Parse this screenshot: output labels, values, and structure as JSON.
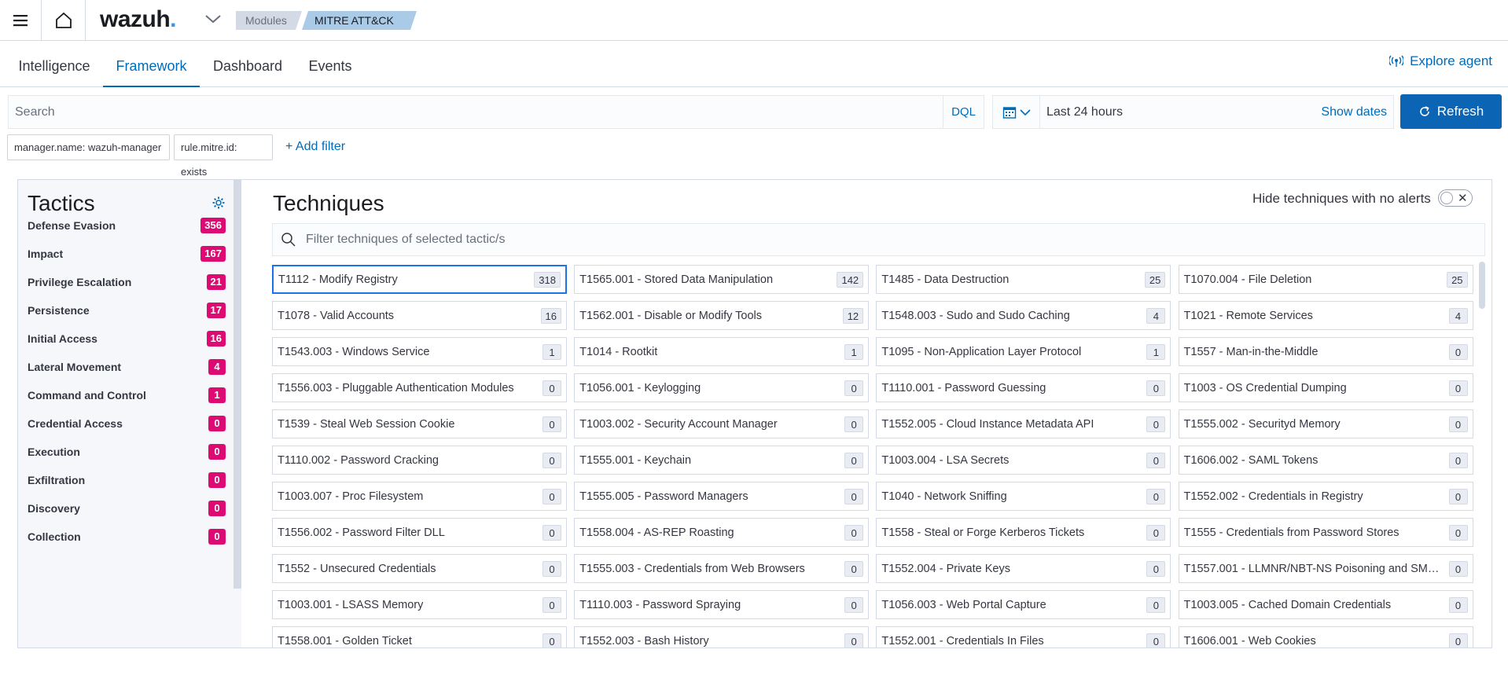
{
  "header": {
    "logo_text": "wazuh",
    "logo_dot": ".",
    "breadcrumbs": [
      "Modules",
      "MITRE ATT&CK"
    ],
    "info_icon": "info-icon"
  },
  "tabs": [
    {
      "label": "Intelligence",
      "active": false
    },
    {
      "label": "Framework",
      "active": true
    },
    {
      "label": "Dashboard",
      "active": false
    },
    {
      "label": "Events",
      "active": false
    }
  ],
  "explore_agent": "Explore agent",
  "search": {
    "placeholder": "Search",
    "value": "",
    "dql_label": "DQL"
  },
  "date_picker": {
    "label": "Last 24 hours",
    "show_dates": "Show dates"
  },
  "refresh_label": "Refresh",
  "filters": [
    "manager.name: wazuh-manager",
    "rule.mitre.id: exists"
  ],
  "add_filter": "+ Add filter",
  "tactics": {
    "title": "Tactics",
    "items": [
      {
        "label": "Defense Evasion",
        "count": "356"
      },
      {
        "label": "Impact",
        "count": "167"
      },
      {
        "label": "Privilege Escalation",
        "count": "21"
      },
      {
        "label": "Persistence",
        "count": "17"
      },
      {
        "label": "Initial Access",
        "count": "16"
      },
      {
        "label": "Lateral Movement",
        "count": "4"
      },
      {
        "label": "Command and Control",
        "count": "1"
      },
      {
        "label": "Credential Access",
        "count": "0"
      },
      {
        "label": "Execution",
        "count": "0"
      },
      {
        "label": "Exfiltration",
        "count": "0"
      },
      {
        "label": "Discovery",
        "count": "0"
      },
      {
        "label": "Collection",
        "count": "0"
      }
    ]
  },
  "techniques": {
    "title": "Techniques",
    "hide_label": "Hide techniques with no alerts",
    "filter_placeholder": "Filter techniques of selected tactic/s",
    "items": [
      {
        "label": "T1112 - Modify Registry",
        "count": "318"
      },
      {
        "label": "T1565.001 - Stored Data Manipulation",
        "count": "142"
      },
      {
        "label": "T1485 - Data Destruction",
        "count": "25"
      },
      {
        "label": "T1070.004 - File Deletion",
        "count": "25"
      },
      {
        "label": "T1078 - Valid Accounts",
        "count": "16"
      },
      {
        "label": "T1562.001 - Disable or Modify Tools",
        "count": "12"
      },
      {
        "label": "T1548.003 - Sudo and Sudo Caching",
        "count": "4"
      },
      {
        "label": "T1021 - Remote Services",
        "count": "4"
      },
      {
        "label": "T1543.003 - Windows Service",
        "count": "1"
      },
      {
        "label": "T1014 - Rootkit",
        "count": "1"
      },
      {
        "label": "T1095 - Non-Application Layer Protocol",
        "count": "1"
      },
      {
        "label": "T1557 - Man-in-the-Middle",
        "count": "0"
      },
      {
        "label": "T1556.003 - Pluggable Authentication Modules",
        "count": "0"
      },
      {
        "label": "T1056.001 - Keylogging",
        "count": "0"
      },
      {
        "label": "T1110.001 - Password Guessing",
        "count": "0"
      },
      {
        "label": "T1003 - OS Credential Dumping",
        "count": "0"
      },
      {
        "label": "T1539 - Steal Web Session Cookie",
        "count": "0"
      },
      {
        "label": "T1003.002 - Security Account Manager",
        "count": "0"
      },
      {
        "label": "T1552.005 - Cloud Instance Metadata API",
        "count": "0"
      },
      {
        "label": "T1555.002 - Securityd Memory",
        "count": "0"
      },
      {
        "label": "T1110.002 - Password Cracking",
        "count": "0"
      },
      {
        "label": "T1555.001 - Keychain",
        "count": "0"
      },
      {
        "label": "T1003.004 - LSA Secrets",
        "count": "0"
      },
      {
        "label": "T1606.002 - SAML Tokens",
        "count": "0"
      },
      {
        "label": "T1003.007 - Proc Filesystem",
        "count": "0"
      },
      {
        "label": "T1555.005 - Password Managers",
        "count": "0"
      },
      {
        "label": "T1040 - Network Sniffing",
        "count": "0"
      },
      {
        "label": "T1552.002 - Credentials in Registry",
        "count": "0"
      },
      {
        "label": "T1556.002 - Password Filter DLL",
        "count": "0"
      },
      {
        "label": "T1558.004 - AS-REP Roasting",
        "count": "0"
      },
      {
        "label": "T1558 - Steal or Forge Kerberos Tickets",
        "count": "0"
      },
      {
        "label": "T1555 - Credentials from Password Stores",
        "count": "0"
      },
      {
        "label": "T1552 - Unsecured Credentials",
        "count": "0"
      },
      {
        "label": "T1555.003 - Credentials from Web Browsers",
        "count": "0"
      },
      {
        "label": "T1552.004 - Private Keys",
        "count": "0"
      },
      {
        "label": "T1557.001 - LLMNR/NBT-NS Poisoning and SMB...",
        "count": "0"
      },
      {
        "label": "T1003.001 - LSASS Memory",
        "count": "0"
      },
      {
        "label": "T1110.003 - Password Spraying",
        "count": "0"
      },
      {
        "label": "T1056.003 - Web Portal Capture",
        "count": "0"
      },
      {
        "label": "T1003.005 - Cached Domain Credentials",
        "count": "0"
      },
      {
        "label": "T1558.001 - Golden Ticket",
        "count": "0"
      },
      {
        "label": "T1552.003 - Bash History",
        "count": "0"
      },
      {
        "label": "T1552.001 - Credentials In Files",
        "count": "0"
      },
      {
        "label": "T1606.001 - Web Cookies",
        "count": "0"
      }
    ]
  },
  "colors": {
    "accent": "#006bb8",
    "badge": "#dd0a73",
    "refresh": "#0b64b4",
    "selected_border": "#1a73e8"
  }
}
